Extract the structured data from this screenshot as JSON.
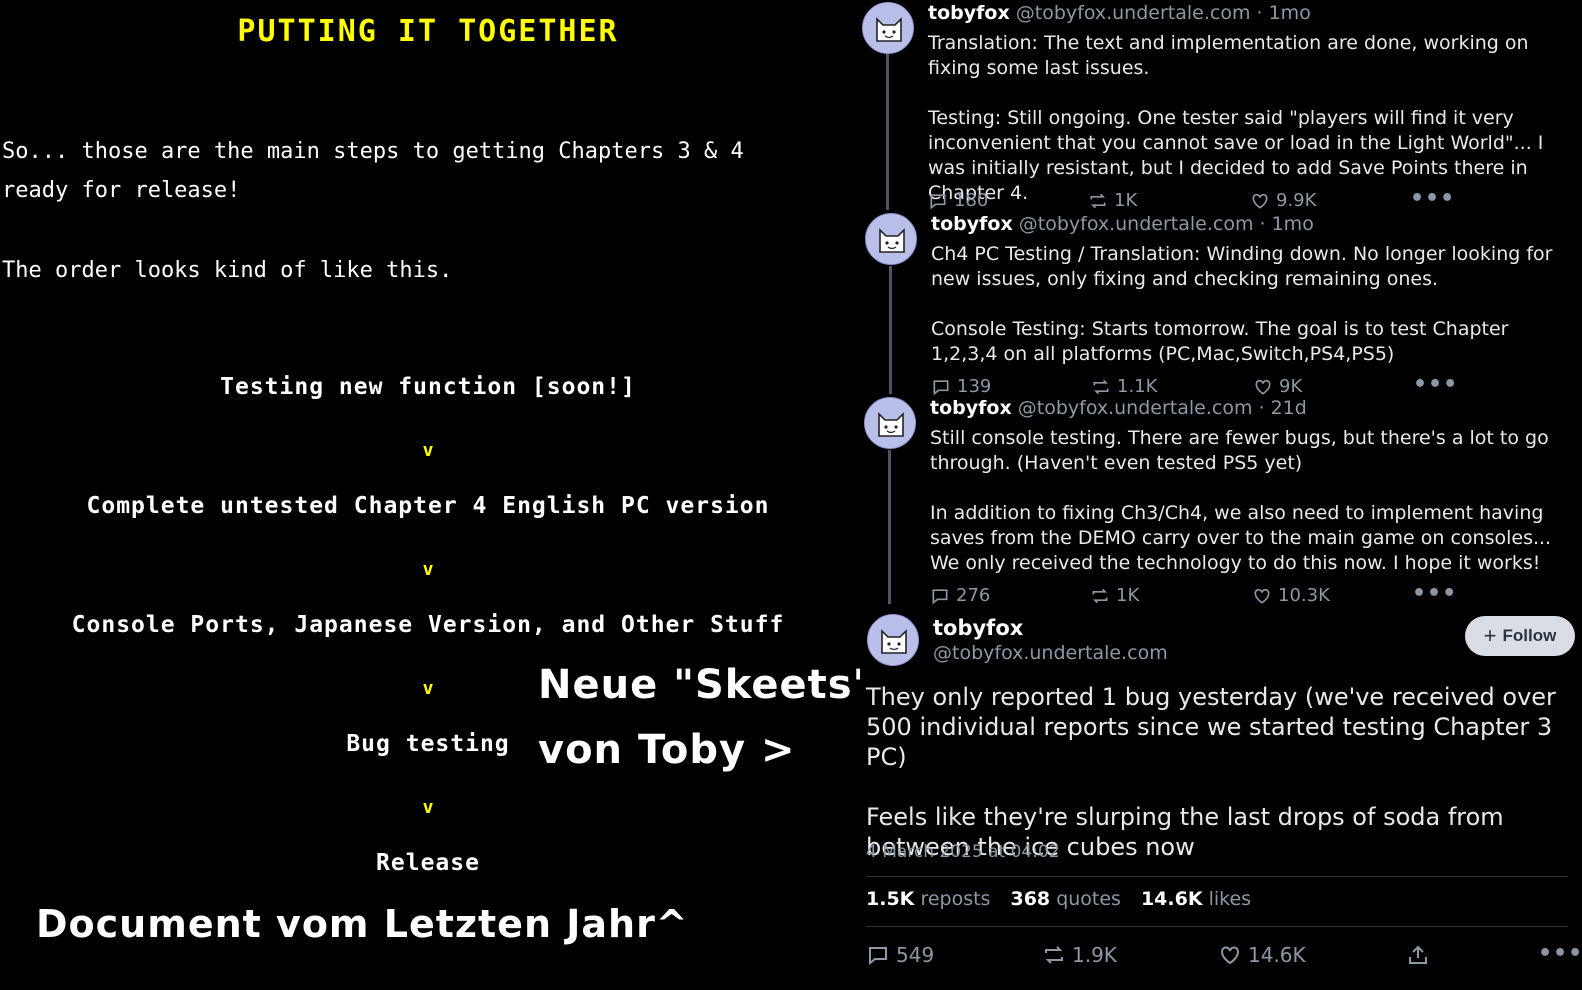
{
  "document": {
    "title": "PUTTING IT TOGETHER",
    "paragraph1": "So... those are the main steps to getting Chapters 3 & 4 ready for release!",
    "paragraph2": "The order looks kind of like this.",
    "steps": [
      "Testing new function [soon!]",
      "Complete untested Chapter 4 English PC version",
      "Console Ports, Japanese Version, and Other Stuff",
      "Bug testing",
      "Release"
    ],
    "arrow": "v"
  },
  "overlay": {
    "line1": "Neue \"Skeets\"",
    "line2": "von Toby >",
    "caption": "Document vom Letzten Jahr^"
  },
  "thread": {
    "posts": [
      {
        "name": "tobyfox",
        "handle": "@tobyfox.undertale.com",
        "time": "· 1mo",
        "text": "Translation: The text and implementation are done, working on fixing some last issues.\n\nTesting: Still ongoing. One tester said \"players will find it very inconvenient that you cannot save or load in the Light World\"... I was initially resistant, but I decided to add Save Points there in Chapter 4.",
        "replies": "180",
        "reposts": "1K",
        "likes": "9.9K"
      },
      {
        "name": "tobyfox",
        "handle": "@tobyfox.undertale.com",
        "time": "· 1mo",
        "text": "Ch4 PC Testing / Translation: Winding down. No longer looking for new issues, only fixing and checking remaining ones.\n\nConsole Testing: Starts tomorrow. The goal is to test Chapter 1,2,3,4 on all platforms (PC,Mac,Switch,PS4,PS5)",
        "replies": "139",
        "reposts": "1.1K",
        "likes": "9K"
      },
      {
        "name": "tobyfox",
        "handle": "@tobyfox.undertale.com",
        "time": "· 21d",
        "text": "Still console testing. There are fewer bugs, but there's a lot to go through. (Haven't even tested PS5 yet)\n\nIn addition to fixing Ch3/Ch4, we also need to implement having saves from the DEMO carry over to the main game on consoles... We only received the technology to do this now. I hope it works!",
        "replies": "276",
        "reposts": "1K",
        "likes": "10.3K"
      }
    ],
    "main": {
      "name": "tobyfox",
      "handle": "@tobyfox.undertale.com",
      "follow_label": "Follow",
      "text": "They only reported 1 bug yesterday (we've received over 500 individual reports since we started testing Chapter 3 PC)\n\nFeels like they're slurping the last drops of soda from between the ice cubes now",
      "date": "4 March 2025 at 04:02",
      "reposts_count": "1.5K",
      "reposts_label": "reposts",
      "quotes_count": "368",
      "quotes_label": "quotes",
      "likes_count": "14.6K",
      "likes_label": "likes",
      "replies": "549",
      "reposts": "1.9K",
      "likes": "14.6K"
    }
  },
  "icons": [
    "reply-icon",
    "repost-icon",
    "like-icon",
    "more-icon",
    "share-icon",
    "plus-icon"
  ]
}
